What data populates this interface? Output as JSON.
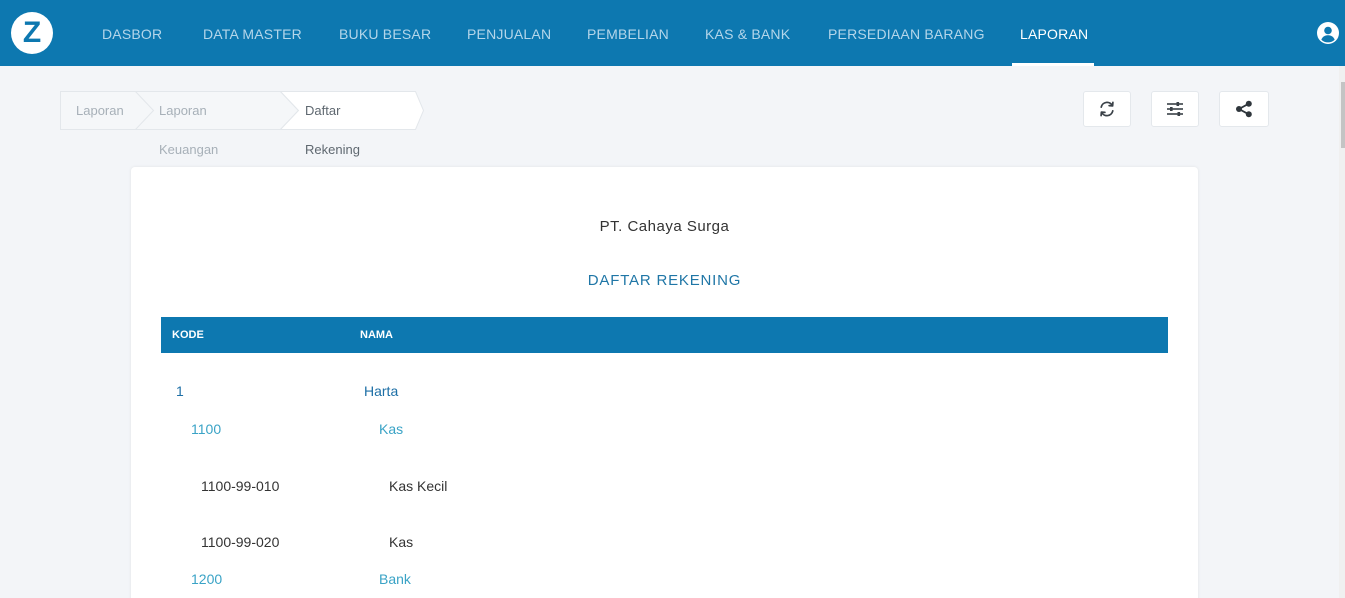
{
  "app": {
    "logo_letter": "Z"
  },
  "nav": {
    "items": [
      {
        "label": "DASBOR"
      },
      {
        "label": "DATA MASTER"
      },
      {
        "label": "BUKU BESAR"
      },
      {
        "label": "PENJUALAN"
      },
      {
        "label": "PEMBELIAN"
      },
      {
        "label": "KAS & BANK"
      },
      {
        "label": "PERSEDIAAN BARANG"
      },
      {
        "label": "LAPORAN"
      }
    ],
    "active": "LAPORAN"
  },
  "breadcrumb": [
    {
      "label": "Laporan"
    },
    {
      "label": "Laporan Keuangan"
    },
    {
      "label": "Daftar Rekening"
    }
  ],
  "toolbar": {
    "refresh_icon": "refresh-icon",
    "filter_icon": "sliders-icon",
    "share_icon": "share-icon"
  },
  "report": {
    "company": "PT. Cahaya Surga",
    "title": "DAFTAR REKENING",
    "columns": {
      "code": "KODE",
      "name": "NAMA"
    },
    "rows": [
      {
        "code": "1",
        "name": "Harta",
        "level": 1
      },
      {
        "code": "1100",
        "name": "Kas",
        "level": 2
      },
      {
        "code": "1100-99-010",
        "name": "Kas Kecil",
        "level": 3
      },
      {
        "code": "1100-99-020",
        "name": "Kas",
        "level": 3
      },
      {
        "code": "1200",
        "name": "Bank",
        "level": 2
      }
    ]
  },
  "colors": {
    "primary": "#0d78b0",
    "level1_text": "#1d6fa6",
    "level2_text": "#3aa3c6",
    "level3_text": "#333333"
  }
}
